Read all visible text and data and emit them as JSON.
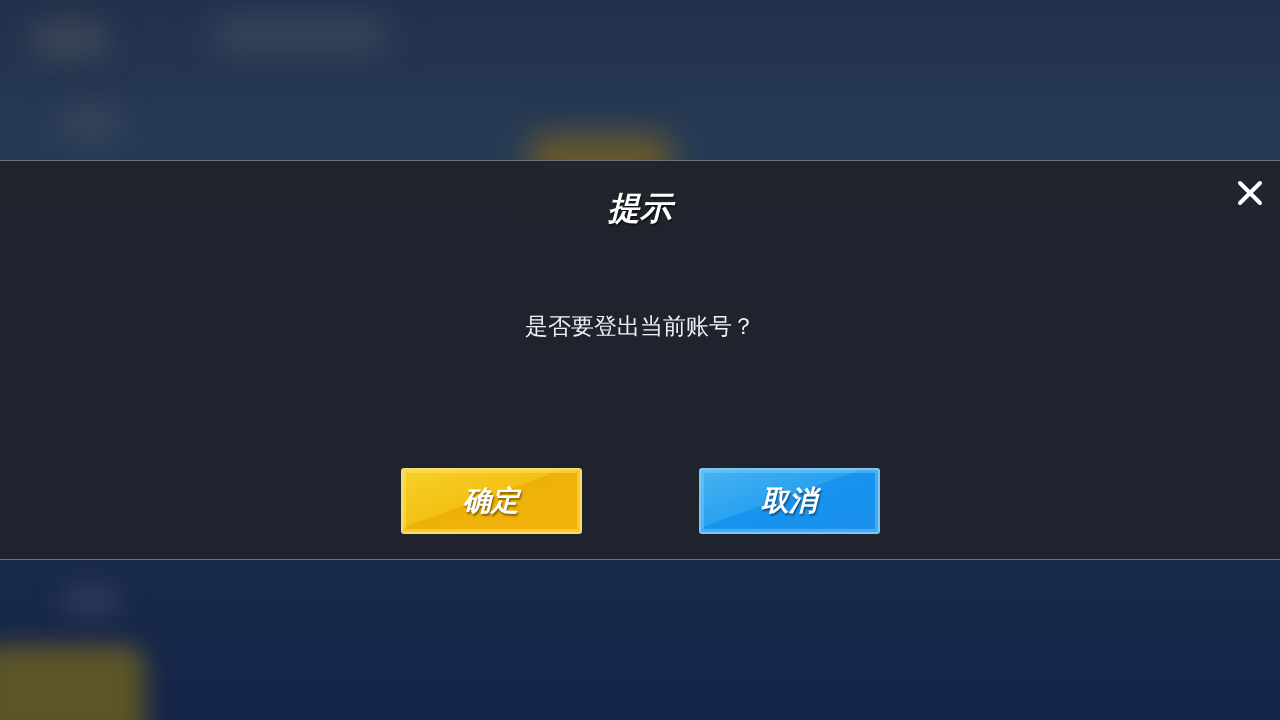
{
  "dialog": {
    "title": "提示",
    "message": "是否要登出当前账号？",
    "buttons": [
      {
        "label": "确定",
        "kind": "confirm"
      },
      {
        "label": "取消",
        "kind": "cancel"
      }
    ]
  }
}
